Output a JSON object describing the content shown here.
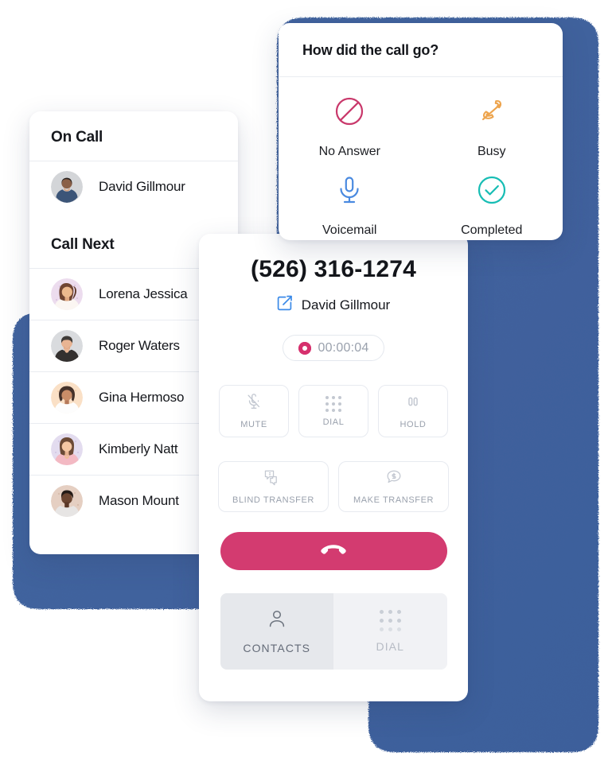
{
  "theme": {
    "backdrop_blue": "#41639f",
    "accent_pink": "#d33b70",
    "record_red": "#d6306d",
    "link_blue": "#3b8ae8",
    "busy_orange": "#eda44d",
    "completed_teal": "#17bdb4",
    "no_answer_crimson": "#c9386b",
    "voicemail_blue": "#4a8ae0"
  },
  "contacts_panel": {
    "on_call_heading": "On Call",
    "on_call": [
      {
        "name": "David Gillmour",
        "avatar": "avatar-david"
      }
    ],
    "call_next_heading": "Call Next",
    "call_next": [
      {
        "name": "Lorena Jessica",
        "avatar": "avatar-lorena"
      },
      {
        "name": "Roger Waters",
        "avatar": "avatar-roger"
      },
      {
        "name": "Gina Hermoso",
        "avatar": "avatar-gina"
      },
      {
        "name": "Kimberly Natt",
        "avatar": "avatar-kimberly"
      },
      {
        "name": "Mason Mount",
        "avatar": "avatar-mason"
      }
    ]
  },
  "dialer": {
    "phone_number": "(526) 316-1274",
    "callee_name": "David Gillmour",
    "external_link_icon": "external-link-icon",
    "timer": "00:00:04",
    "record_icon": "record-dot-icon",
    "controls": [
      {
        "label": "MUTE",
        "icon": "mic-off-icon"
      },
      {
        "label": "DIAL",
        "icon": "keypad-icon"
      },
      {
        "label": "HOLD",
        "icon": "pause-icon"
      }
    ],
    "transfer_controls": [
      {
        "label": "BLIND TRANSFER",
        "icon": "two-chat-bubbles-icon"
      },
      {
        "label": "MAKE TRANSFER",
        "icon": "chat-bubble-icon"
      }
    ],
    "hangup_icon": "hangup-phone-icon",
    "tabs": [
      {
        "label": "CONTACTS",
        "icon": "person-icon",
        "active": true
      },
      {
        "label": "DIAL",
        "icon": "keypad-icon",
        "active": false
      }
    ]
  },
  "outcome_modal": {
    "title": "How did the call go?",
    "options": [
      {
        "label": "No Answer",
        "icon": "no-entry-icon",
        "color": "#c9386b"
      },
      {
        "label": "Busy",
        "icon": "phone-off-icon",
        "color": "#eda44d"
      },
      {
        "label": "Voicemail",
        "icon": "microphone-icon",
        "color": "#4a8ae0"
      },
      {
        "label": "Completed",
        "icon": "check-circle-icon",
        "color": "#17bdb4"
      }
    ]
  }
}
